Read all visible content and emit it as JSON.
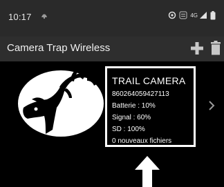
{
  "status_bar": {
    "time": "10:17",
    "network_label": "4G",
    "icons": [
      "notification-icon",
      "vibrate-icon",
      "volte-icon",
      "signal-icon",
      "battery-icon"
    ]
  },
  "app_bar": {
    "title": "Camera Trap Wireless",
    "icons": [
      "add-icon",
      "delete-icon"
    ]
  },
  "device": {
    "logo": "deer-head-logo",
    "name": "TRAIL CAMERA",
    "imei": "860264059427113",
    "battery": "Batterie : 10%",
    "signal": "Signal : 60%",
    "sd": "SD : 100%",
    "new_files": "0 nouveaux fichiers",
    "chevron": "chevron-right-icon"
  },
  "annotation": {
    "icon": "up-arrow-annotation"
  },
  "colors": {
    "status_bar_bg": "#2a2a2a",
    "app_bar_bg": "#2e2e2e",
    "content_bg": "#000000",
    "text": "#ffffff",
    "icon_gray": "#c8c8c8"
  }
}
